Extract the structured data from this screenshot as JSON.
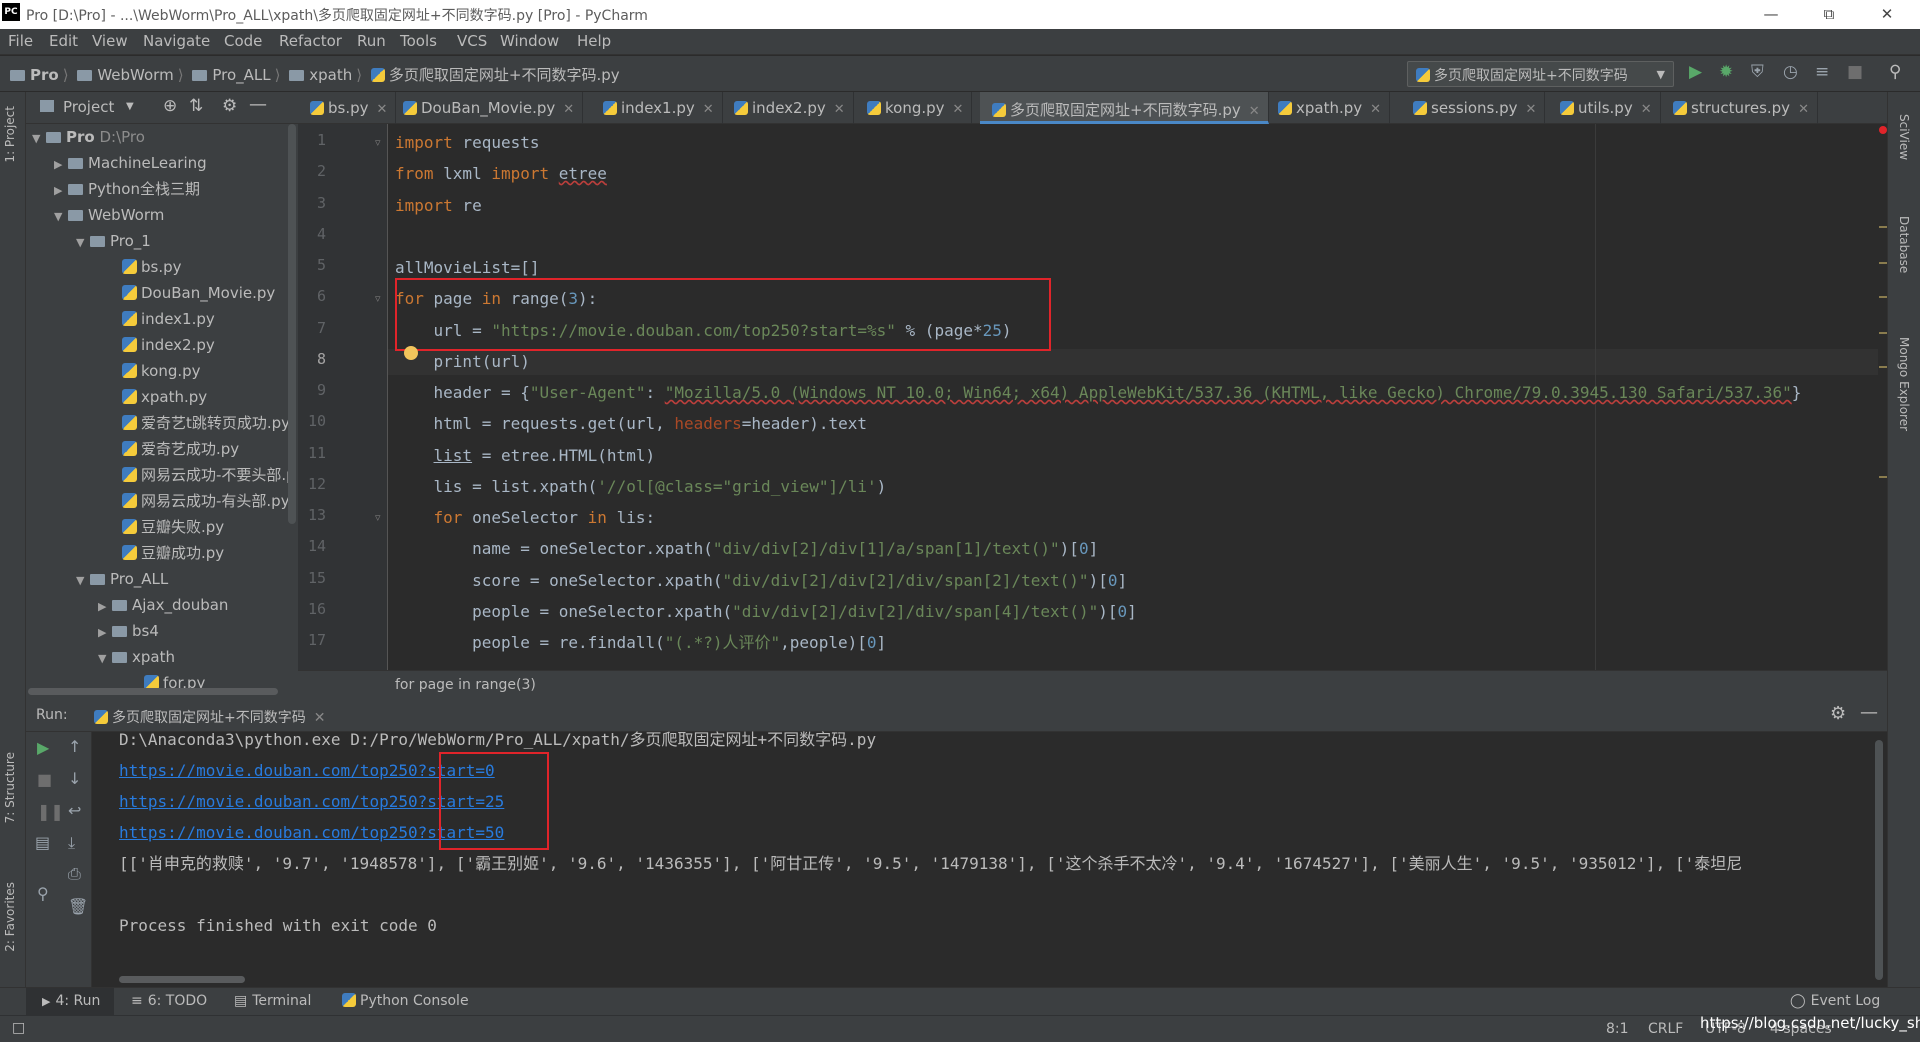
{
  "window": {
    "title": "Pro [D:\\Pro] - ...\\WebWorm\\Pro_ALL\\xpath\\多页爬取固定网址+不同数字码.py [Pro] - PyCharm",
    "logo": "PC"
  },
  "menu": [
    "File",
    "Edit",
    "View",
    "Navigate",
    "Code",
    "Refactor",
    "Run",
    "Tools",
    "VCS",
    "Window",
    "Help"
  ],
  "breadcrumb": [
    "Pro",
    "WebWorm",
    "Pro_ALL",
    "xpath",
    "多页爬取固定网址+不同数字码.py"
  ],
  "run_config": "多页爬取固定网址+不同数字码",
  "project_panel": {
    "title": "Project",
    "tree": [
      {
        "label": "Pro",
        "extra": "D:\\Pro",
        "level": 0,
        "type": "folder",
        "open": true
      },
      {
        "label": "MachineLearing",
        "level": 1,
        "type": "folder",
        "open": false
      },
      {
        "label": "Python全栈三期",
        "level": 1,
        "type": "folder",
        "open": false
      },
      {
        "label": "WebWorm",
        "level": 1,
        "type": "folder",
        "open": true
      },
      {
        "label": "Pro_1",
        "level": 2,
        "type": "folder",
        "open": true
      },
      {
        "label": "bs.py",
        "level": 3,
        "type": "file"
      },
      {
        "label": "DouBan_Movie.py",
        "level": 3,
        "type": "file"
      },
      {
        "label": "index1.py",
        "level": 3,
        "type": "file"
      },
      {
        "label": "index2.py",
        "level": 3,
        "type": "file"
      },
      {
        "label": "kong.py",
        "level": 3,
        "type": "file"
      },
      {
        "label": "xpath.py",
        "level": 3,
        "type": "file"
      },
      {
        "label": "爱奇艺t跳转页成功.py",
        "level": 3,
        "type": "file"
      },
      {
        "label": "爱奇艺成功.py",
        "level": 3,
        "type": "file"
      },
      {
        "label": "网易云成功-不要头部.p",
        "level": 3,
        "type": "file"
      },
      {
        "label": "网易云成功-有头部.py",
        "level": 3,
        "type": "file"
      },
      {
        "label": "豆瓣失败.py",
        "level": 3,
        "type": "file"
      },
      {
        "label": "豆瓣成功.py",
        "level": 3,
        "type": "file"
      },
      {
        "label": "Pro_ALL",
        "level": 2,
        "type": "folder",
        "open": true
      },
      {
        "label": "Ajax_douban",
        "level": 3,
        "type": "folder",
        "open": false
      },
      {
        "label": "bs4",
        "level": 3,
        "type": "folder",
        "open": false
      },
      {
        "label": "xpath",
        "level": 3,
        "type": "folder",
        "open": true
      },
      {
        "label": "for.py",
        "level": 4,
        "type": "file"
      }
    ]
  },
  "tabs": [
    "bs.py",
    "DouBan_Movie.py",
    "index1.py",
    "index2.py",
    "kong.py",
    "多页爬取固定网址+不同数字码.py",
    "xpath.py",
    "sessions.py",
    "utils.py",
    "structures.py"
  ],
  "active_tab": 5,
  "line_numbers": [
    "1",
    "2",
    "3",
    "4",
    "5",
    "6",
    "7",
    "8",
    "9",
    "10",
    "11",
    "12",
    "13",
    "14",
    "15",
    "16",
    "17"
  ],
  "code_breadcrumb": "for page in range(3)",
  "run_panel": {
    "label": "Run:",
    "tab": "多页爬取固定网址+不同数字码",
    "output": {
      "cmd": "D:\\Anaconda3\\python.exe D:/Pro/WebWorm/Pro_ALL/xpath/多页爬取固定网址+不同数字码.py",
      "links": [
        "https://movie.douban.com/top250?start=0",
        "https://movie.douban.com/top250?start=25",
        "https://movie.douban.com/top250?start=50"
      ],
      "list": "[['肖申克的救赎', '9.7', '1948578'], ['霸王别姬', '9.6', '1436355'], ['阿甘正传', '9.5', '1479138'], ['这个杀手不太冷', '9.4', '1674527'], ['美丽人生', '9.5', '935012'], ['泰坦尼",
      "finish": "Process finished with exit code 0"
    }
  },
  "bottom_tabs": [
    "4: Run",
    "6: TODO",
    "Terminal",
    "Python Console"
  ],
  "event_log": "Event Log",
  "status": {
    "position": "8:1",
    "line_sep": "CRLF",
    "encoding": "UTF-8",
    "indent": "4 spaces",
    "watermark": "https://blog.csdn.net/lucky_shi"
  },
  "side_labels": {
    "left": [
      "1: Project",
      "7: Structure",
      "2: Favorites"
    ],
    "right": [
      "SciView",
      "Database",
      "Mongo Explorer"
    ]
  },
  "colors": {
    "keyword": "#cc7832",
    "string": "#6a8759",
    "number": "#6897bb",
    "link": "#287bde",
    "highlight_box": "#e0242a"
  }
}
